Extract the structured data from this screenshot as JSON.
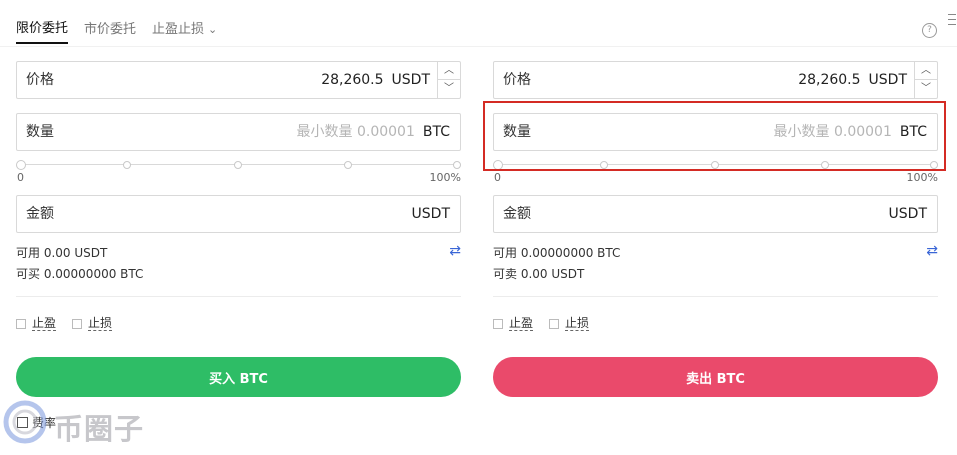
{
  "tabs": [
    {
      "label": "限价委托",
      "active": true
    },
    {
      "label": "市价委托",
      "active": false
    },
    {
      "label": "止盈止损",
      "active": false
    }
  ],
  "buy": {
    "price_label": "价格",
    "price_value": "28,260.5",
    "price_unit": "USDT",
    "qty_label": "数量",
    "qty_placeholder": "最小数量 0.00001",
    "qty_unit": "BTC",
    "slider_min": "0",
    "slider_max": "100%",
    "slider_value": 0,
    "amount_label": "金额",
    "amount_unit": "USDT",
    "available": "可用 0.00 USDT",
    "can_trade": "可买 0.00000000 BTC",
    "take_profit": "止盈",
    "stop_loss": "止损",
    "button": "买入 BTC"
  },
  "sell": {
    "price_label": "价格",
    "price_value": "28,260.5",
    "price_unit": "USDT",
    "qty_label": "数量",
    "qty_placeholder": "最小数量 0.00001",
    "qty_unit": "BTC",
    "slider_min": "0",
    "slider_max": "100%",
    "slider_value": 0,
    "amount_label": "金额",
    "amount_unit": "USDT",
    "available": "可用 0.00000000 BTC",
    "can_trade": "可卖 0.00 USDT",
    "take_profit": "止盈",
    "stop_loss": "止损",
    "button": "卖出 BTC"
  },
  "fee_label": "费率",
  "watermark": "币圈子",
  "colors": {
    "buy": "#2ebd66",
    "sell": "#ea4a6b",
    "highlight": "#d42b24",
    "swap": "#3a66d6"
  },
  "icons": {
    "help": "question-circle-icon",
    "menu": "menu-icon",
    "swap": "swap-icon",
    "chevron": "chevron-down-icon"
  }
}
